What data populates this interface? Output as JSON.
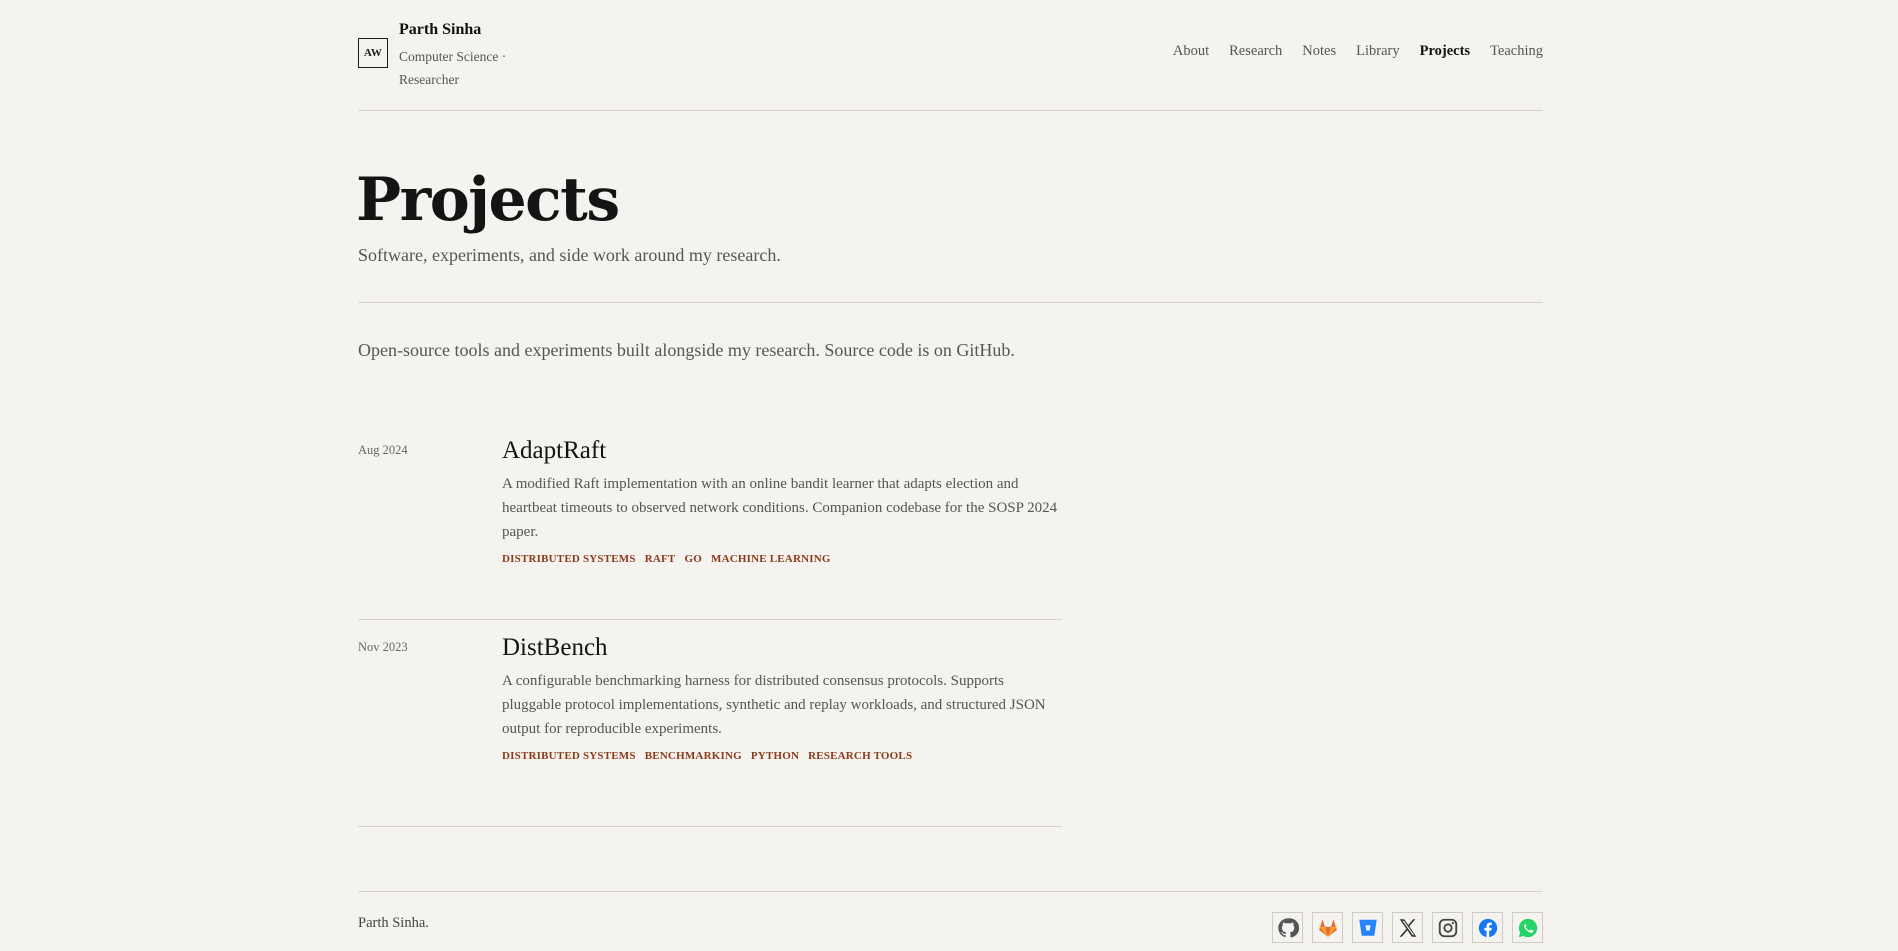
{
  "header": {
    "logo_text": "AW",
    "name": "Parth Sinha",
    "tagline": "Computer Science · Researcher",
    "nav": [
      {
        "label": "About"
      },
      {
        "label": "Research"
      },
      {
        "label": "Notes"
      },
      {
        "label": "Library"
      },
      {
        "label": "Projects",
        "active": true
      },
      {
        "label": "Teaching"
      }
    ]
  },
  "hero": {
    "title": "Projects",
    "subtitle": "Software, experiments, and side work around my research."
  },
  "intro": "Open-source tools and experiments built alongside my research. Source code is on GitHub.",
  "projects": [
    {
      "date": "Aug 2024",
      "title": "AdaptRaft",
      "description": "A modified Raft implementation with an online bandit learner that adapts election and heartbeat timeouts to observed network conditions. Companion codebase for the SOSP 2024 paper.",
      "tags": [
        "Distributed Systems",
        "Raft",
        "Go",
        "Machine Learning"
      ]
    },
    {
      "date": "Nov 2023",
      "title": "DistBench",
      "description": "A configurable benchmarking harness for distributed consensus protocols. Supports pluggable protocol implementations, synthetic and replay workloads, and structured JSON output for reproducible experiments.",
      "tags": [
        "Distributed Systems",
        "Benchmarking",
        "Python",
        "Research Tools"
      ]
    }
  ],
  "footer": {
    "copyright": "Parth Sinha.",
    "socials": [
      {
        "icon": "github-icon",
        "color": "#555555"
      },
      {
        "icon": "gitlab-icon",
        "color": "#e2683c"
      },
      {
        "icon": "bitbucket-icon",
        "color": "#2684ff"
      },
      {
        "icon": "x-icon",
        "color": "#333333"
      },
      {
        "icon": "instagram-icon",
        "color": "#444444"
      },
      {
        "icon": "facebook-icon",
        "color": "#1877f2"
      },
      {
        "icon": "whatsapp-icon",
        "color": "#25d366"
      }
    ]
  }
}
